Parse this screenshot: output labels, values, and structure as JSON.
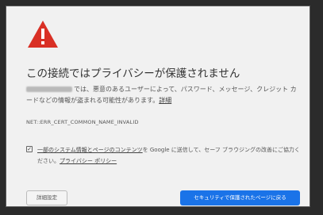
{
  "page": {
    "title": "この接続ではプライバシーが保護されません",
    "description_before_link": "では、悪意のあるユーザーによって、パスワード、メッセージ、クレジット カードなどの情報が盗まれる可能性があります。",
    "details_link": "詳細",
    "error_code": "NET::ERR_CERT_COMMON_NAME_INVALID"
  },
  "report": {
    "checkbox_checked": true,
    "part1": "一部のシステム情報とページのコンテンツ",
    "part2": "を Google に送信して、セーフ ブラウジングの改善にご協力ください。",
    "privacy_link": "プライバシー ポリシー"
  },
  "buttons": {
    "advanced": "詳細設定",
    "back_to_safety": "セキュリティで保護されたページに戻る"
  },
  "colors": {
    "warning_red": "#d93025",
    "primary_blue": "#1a73e8"
  },
  "icons": {
    "warning": "warning-triangle-icon"
  }
}
